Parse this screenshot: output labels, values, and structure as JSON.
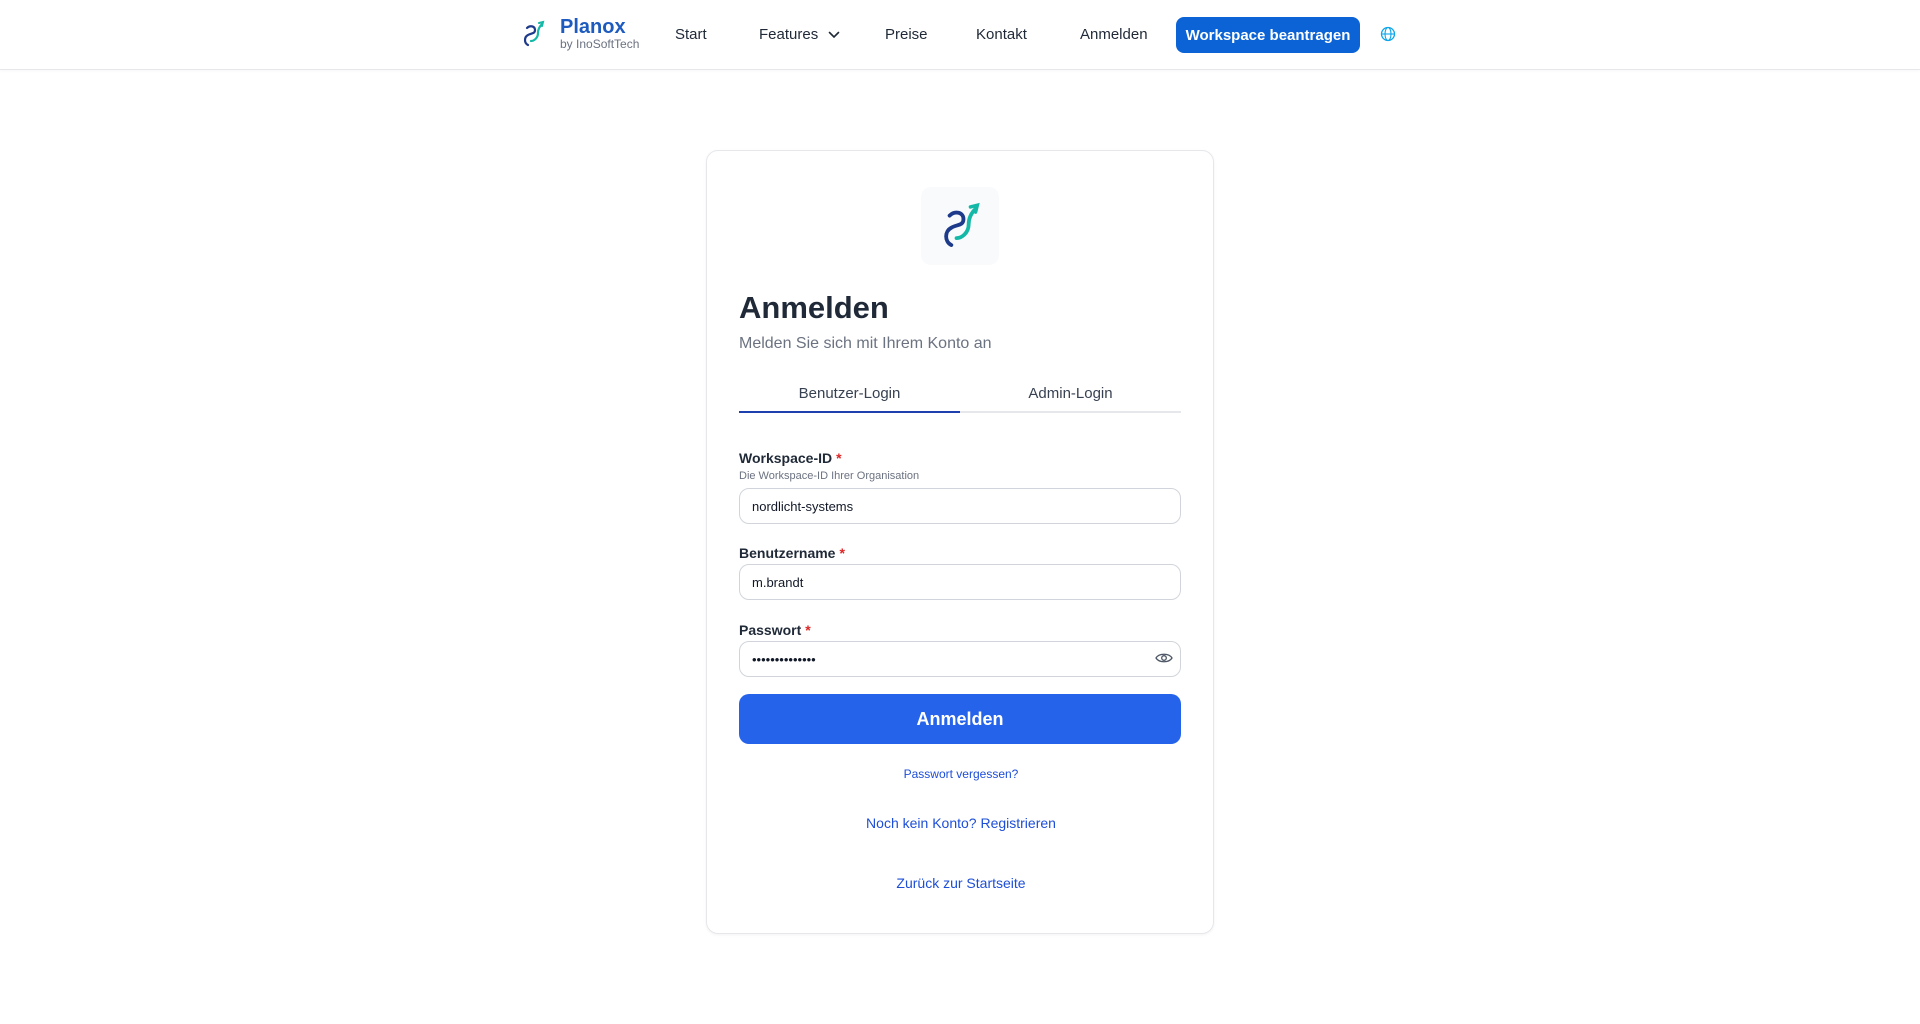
{
  "header": {
    "brand_name": "Planox",
    "brand_sub": "by InoSoftTech",
    "nav": {
      "start": "Start",
      "features": "Features",
      "preise": "Preise",
      "kontakt": "Kontakt",
      "anmelden": "Anmelden"
    },
    "cta": "Workspace beantragen"
  },
  "card": {
    "title": "Anmelden",
    "subtitle": "Melden Sie sich mit Ihrem Konto an",
    "tabs": [
      "Benutzer-Login",
      "Admin-Login"
    ],
    "active_tab": "Benutzer-Login",
    "workspace": {
      "label": "Workspace-ID",
      "required_marker": "*",
      "hint": "Die Workspace-ID Ihrer Organisation",
      "value": "nordlicht-systems"
    },
    "username": {
      "label": "Benutzername",
      "required_marker": "*",
      "value": "m.brandt"
    },
    "password": {
      "label": "Passwort",
      "required_marker": "*",
      "value": "••••••••••••••"
    },
    "submit_label": "Anmelden",
    "forgot_link": "Passwort vergessen?",
    "register_link": "Noch kein Konto? Registrieren",
    "home_link": "Zurück zur Startseite"
  },
  "colors": {
    "primary": "#2563eb",
    "cta": "#0b63d6",
    "brand": "#1e5bbf",
    "required": "#dc2626",
    "link": "#1d4ed8"
  },
  "icons": [
    "planox-logo-icon",
    "chevron-down-icon",
    "globe-icon",
    "eye-icon"
  ]
}
